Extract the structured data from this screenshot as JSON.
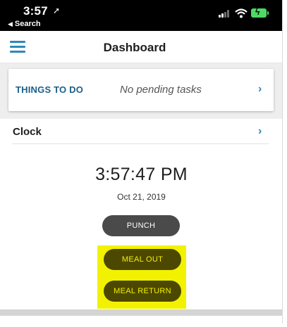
{
  "status_bar": {
    "time": "3:57",
    "back_label": "Search",
    "icons": [
      "location-arrow-icon",
      "signal-icon",
      "wifi-icon",
      "battery-charging-icon"
    ],
    "battery_color": "#4cd964"
  },
  "header": {
    "title": "Dashboard",
    "menu_icon": "hamburger-menu-icon",
    "accent_color": "#2a8ab8"
  },
  "things_to_do": {
    "title": "THINGS TO DO",
    "status": "No pending tasks",
    "chevron": "›"
  },
  "clock": {
    "label": "Clock",
    "chevron": "›",
    "time": "3:57:47 PM",
    "date": "Oct 21, 2019"
  },
  "actions": {
    "punch_label": "PUNCH",
    "meal_out_label": "MEAL OUT",
    "meal_return_label": "MEAL RETURN",
    "highlight_color": "#f2f200"
  }
}
